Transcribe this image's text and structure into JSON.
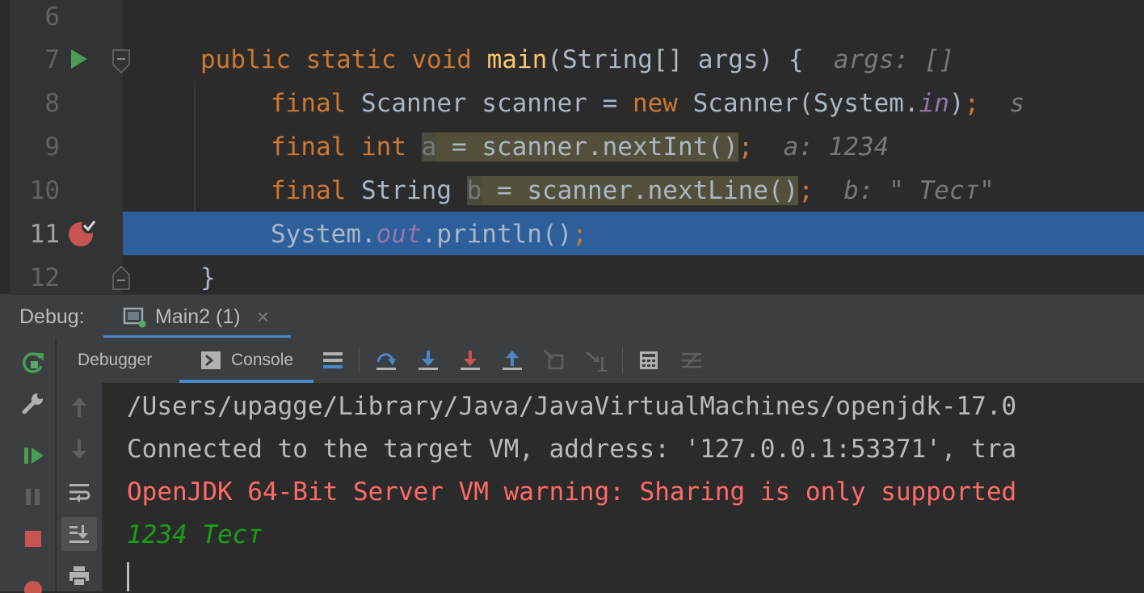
{
  "editor": {
    "line_numbers": [
      "6",
      "7",
      "8",
      "9",
      "10",
      "11",
      "12"
    ],
    "line7": {
      "kw1": "public",
      "kw2": "static",
      "kw3": "void",
      "method": "main",
      "rest": "(String[] args) {",
      "hint": "args: []"
    },
    "line8": {
      "kw1": "final",
      "t1": "Scanner scanner = ",
      "kw2": "new",
      "t2": "Scanner(System.",
      "static": "in",
      "t3": ")",
      "semi": ";",
      "hint": "s"
    },
    "line9": {
      "kw1": "final",
      "kw2": "int",
      "var": "a",
      "rest": " = scanner.nextInt()",
      "semi": ";",
      "hint": "a: 1234"
    },
    "line10": {
      "kw1": "final",
      "t1": "String",
      "var": "b",
      "rest": " = scanner.nextLine()",
      "semi": ";",
      "hint": "b: \" Тест\""
    },
    "line11": {
      "t1": "System.",
      "static": "out",
      "t2": ".println()",
      "semi": ";"
    },
    "line12": {
      "brace": "}"
    }
  },
  "debug": {
    "label": "Debug:",
    "session": "Main2 (1)",
    "close": "×"
  },
  "toolbar": {
    "debugger_tab": "Debugger",
    "console_tab": "Console",
    "active_tab": "Console"
  },
  "console": {
    "lines": [
      "/Users/upagge/Library/Java/JavaVirtualMachines/openjdk-17.0",
      "Connected to the target VM, address: '127.0.0.1:53371', tra",
      "OpenJDK 64-Bit Server VM warning: Sharing is only supported",
      "1234 Тест"
    ]
  },
  "colors": {
    "accent": "#4a88c7",
    "execution_line": "#2d5f9a",
    "error_text": "#ff6b68",
    "input_text": "#17a017"
  }
}
